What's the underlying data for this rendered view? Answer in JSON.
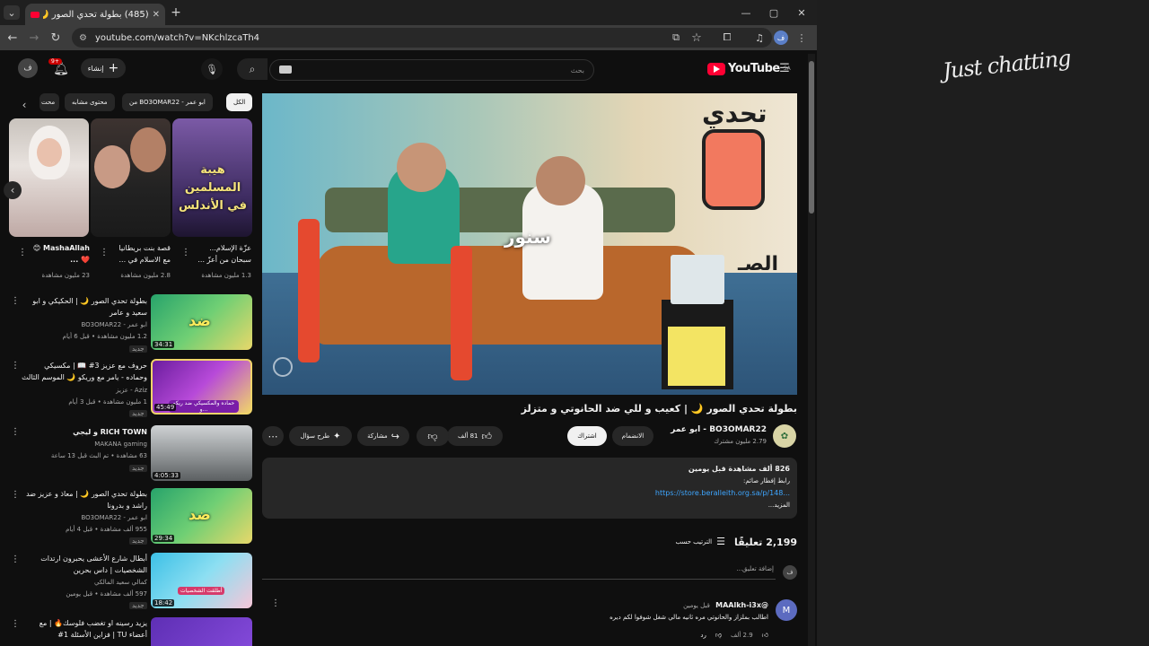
{
  "browser": {
    "tab_title": "(485) بطولة تحدي الصور 🌙",
    "url": "youtube.com/watch?v=NKchlzcaTh4",
    "profile_letter": "ف"
  },
  "yt_header": {
    "logo": "YouTube",
    "region": "SA",
    "search_placeholder": "بحث",
    "create_label": "إنشاء",
    "notif_count": "9+",
    "avatar_letter": "ف"
  },
  "chips": [
    "الكل",
    "من BO3OMAR22 - ابو عمر",
    "محتوى مشابه",
    "محت"
  ],
  "shorts": [
    {
      "title": "عزّة الإسلام... سبحان من أعزّ ...",
      "views": "1.3 مليون مشاهدة",
      "caption": "هيبة المسلمين في الأندلس"
    },
    {
      "title": "قصة بنت بريطانيا مع الاسلام في ...",
      "views": "2.8 مليون مشاهدة"
    },
    {
      "title": "MashaAllah 😊❤️ ...",
      "views": "23 مليون مشاهدة"
    }
  ],
  "related": [
    {
      "title": "بطولة تحدي الصور 🌙 | الحكيكي و ابو سعيد و عامر",
      "channel": "ابو عمر - BO3OMAR22",
      "meta": "1.2 مليون مشاهدة • قبل 6 أيام",
      "badge": "جديد",
      "duration": "34:31",
      "thumb_text": "ضد"
    },
    {
      "title": "حروف مع عزيز 3# 📖 | مكسيكي وحماده - يامر مع وريكو 🌙 الموسم الثالث",
      "channel": "Aziz - عزيز",
      "meta": "1 مليون مشاهدة • قبل 3 أيام",
      "badge": "جديد",
      "duration": "45:49",
      "thumb_text": "حماده والمكسيكي ضد ريكو و..."
    },
    {
      "title": "RICH TOWN و ليجي",
      "channel": "MAKANA gaming",
      "meta": "63 مشاهدة • تم البث قبل 13 ساعة",
      "badge": "جديد",
      "duration": "4:05:33"
    },
    {
      "title": "بطولة تحدي الصور 🌙 | معاذ و عزيز ضد راشد و بدرونا",
      "channel": "ابو عمر - BO3OMAR22",
      "meta": "955 ألف مشاهدة • قبل 4 أيام",
      "badge": "جديد",
      "duration": "29:34",
      "thumb_text": "ضد"
    },
    {
      "title": "أبطال شارع الأعشى يحبرون ارتدات الشخصيات | داس بحرين",
      "channel": "كمالي سعيد المالكي",
      "meta": "597 ألف مشاهدة • قبل يومين",
      "badge": "جديد",
      "duration": "18:42",
      "thumb_text": "أطلقت الشخصيات"
    },
    {
      "title": "يزيد رسينه او تغضب فلوسك🔥 | مع أعضاء TU | فزاين الأسئلة 1#",
      "channel": "",
      "meta": "",
      "badge": "",
      "duration": ""
    }
  ],
  "video": {
    "title": "بطولة تحدي الصور 🌙 | كعيب و للي ضد الحانوتي و متزلز",
    "overlay_text": "سنور",
    "wall_text": "تحدي",
    "wall_text2": "الصـ"
  },
  "channel": {
    "name": "BO3OMAR22 - ابو عمر",
    "subs": "2.79 مليون مشترك",
    "join": "الانضمام",
    "subscribe": "اشتراك"
  },
  "actions": {
    "likes": "81 ألف",
    "share": "مشاركة",
    "ask": "طرح سؤال"
  },
  "description": {
    "stats": "826 ألف مشاهدة  قبل يومين",
    "line1": "رابط إفطار صائم:",
    "link": "https://store.beralleith.org.sa/p/148...",
    "more": "...المزيد"
  },
  "comments": {
    "count": "2,199 تعليقًا",
    "sort": "الترتيب حسب",
    "add_placeholder": "إضافة تعليق...",
    "first": {
      "author": "@MAAlkh-i3x",
      "time": "قبل يومين",
      "text": "اطالب بملزاز والحانوتي مره ثانيه مالي شغل شوفوا لكم ديره",
      "likes": "2.9 ألف",
      "reply": "رد",
      "avatar": "M"
    }
  },
  "stream_overlay": {
    "text": "Just chatting"
  }
}
